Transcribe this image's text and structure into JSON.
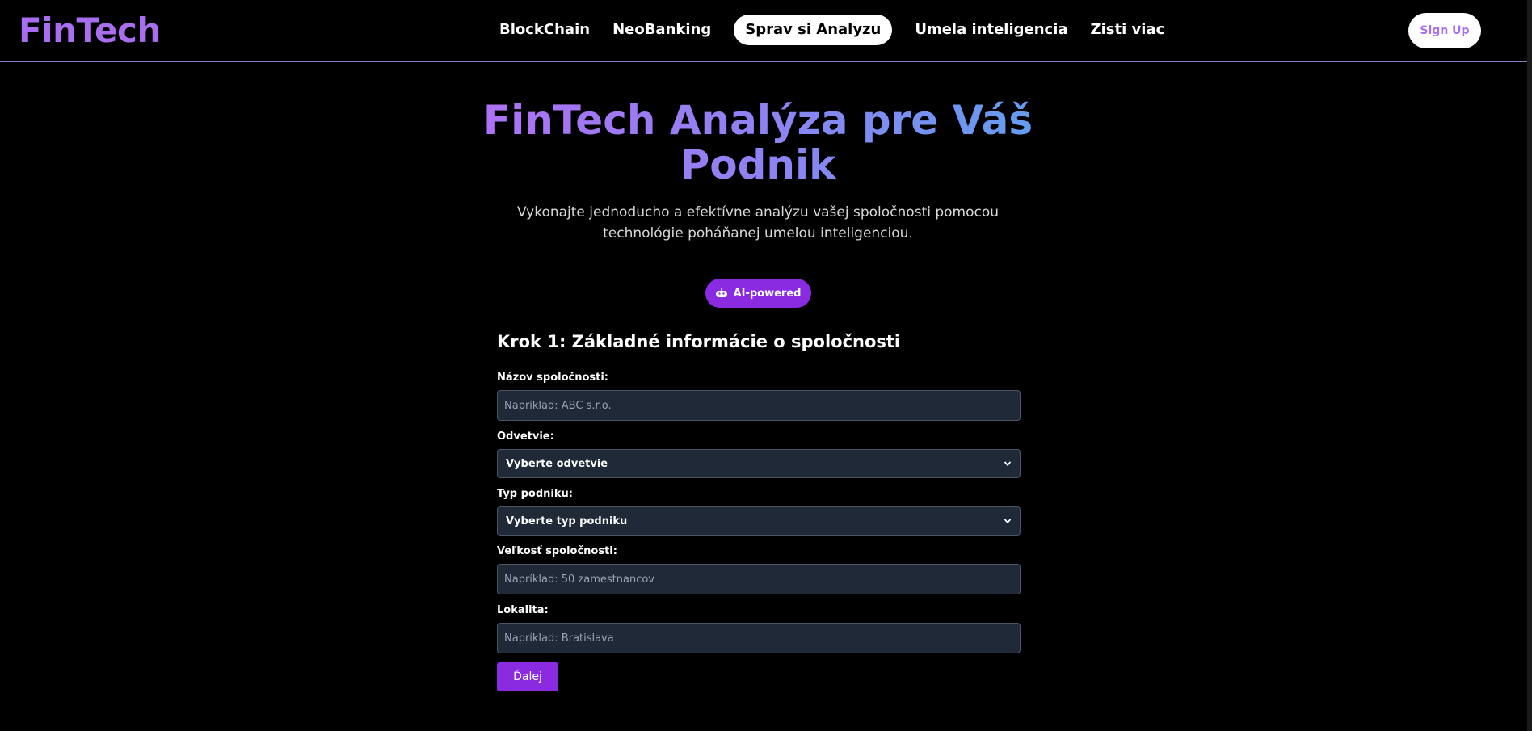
{
  "header": {
    "logo": "FinTech",
    "nav": [
      {
        "label": "BlockChain",
        "active": false
      },
      {
        "label": "NeoBanking",
        "active": false
      },
      {
        "label": "Sprav si Analyzu",
        "active": true
      },
      {
        "label": "Umela inteligencia",
        "active": false
      },
      {
        "label": "Zisti viac",
        "active": false
      }
    ],
    "signup_label": "Sign Up"
  },
  "hero": {
    "title_line1": "FinTech Analýza pre Váš",
    "title_line2": "Podnik",
    "subtitle_line1": "Vykonajte jednoducho a efektívne analýzu vašej spoločnosti pomocou",
    "subtitle_line2": "technológie poháňanej umelou inteligenciou.",
    "badge_icon": "robot-icon",
    "badge_label": "AI-powered"
  },
  "form": {
    "step_title": "Krok 1: Základné informácie o spoločnosti",
    "fields": {
      "company_name": {
        "label": "Názov spoločnosti:",
        "placeholder": "Napríklad: ABC s.r.o."
      },
      "industry": {
        "label": "Odvetvie:",
        "selected": "Vyberte odvetvie"
      },
      "business_type": {
        "label": "Typ podniku:",
        "selected": "Vyberte typ podniku"
      },
      "company_size": {
        "label": "Veľkosť spoločnosti:",
        "placeholder": "Napríklad: 50 zamestnancov"
      },
      "location": {
        "label": "Lokalita:",
        "placeholder": "Napríklad: Bratislava"
      }
    },
    "next_label": "Ďalej"
  },
  "colors": {
    "accent": "#8a2be2",
    "logo": "#a96ef0",
    "input_bg": "#1f2937",
    "background": "#000000"
  }
}
